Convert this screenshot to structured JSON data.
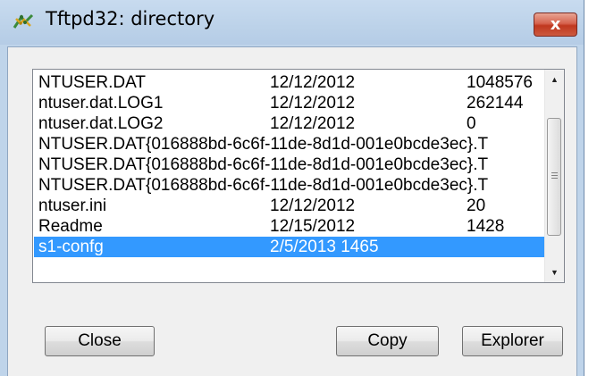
{
  "window": {
    "title": "Tftpd32: directory",
    "close_glyph": "x"
  },
  "files": [
    {
      "name": "NTUSER.DAT",
      "date": "12/12/2012",
      "size": "1048576"
    },
    {
      "name": "ntuser.dat.LOG1",
      "date": "12/12/2012",
      "size": "262144"
    },
    {
      "name": "ntuser.dat.LOG2",
      "date": "12/12/2012",
      "size": "0"
    },
    {
      "name": "NTUSER.DAT{016888bd-6c6f-11de-8d1d-001e0bcde3ec}.T",
      "date": "",
      "size": ""
    },
    {
      "name": "NTUSER.DAT{016888bd-6c6f-11de-8d1d-001e0bcde3ec}.T",
      "date": "",
      "size": ""
    },
    {
      "name": "NTUSER.DAT{016888bd-6c6f-11de-8d1d-001e0bcde3ec}.T",
      "date": "",
      "size": ""
    },
    {
      "name": "ntuser.ini",
      "date": "12/12/2012",
      "size": "20"
    },
    {
      "name": "Readme",
      "date": "12/15/2012",
      "size": "1428"
    },
    {
      "name": "s1-confg",
      "date": "2/5/2013  1465",
      "size": "",
      "selected": true
    }
  ],
  "buttons": {
    "close": "Close",
    "copy": "Copy",
    "explorer": "Explorer"
  },
  "icons": {
    "app": "tftpd32-app-icon",
    "scroll_up": "scroll-up-arrow-icon",
    "scroll_down": "scroll-down-arrow-icon"
  },
  "colors": {
    "selection": "#3399ff",
    "close_button": "#c84a30",
    "titlebar": "#bfd4ea"
  }
}
